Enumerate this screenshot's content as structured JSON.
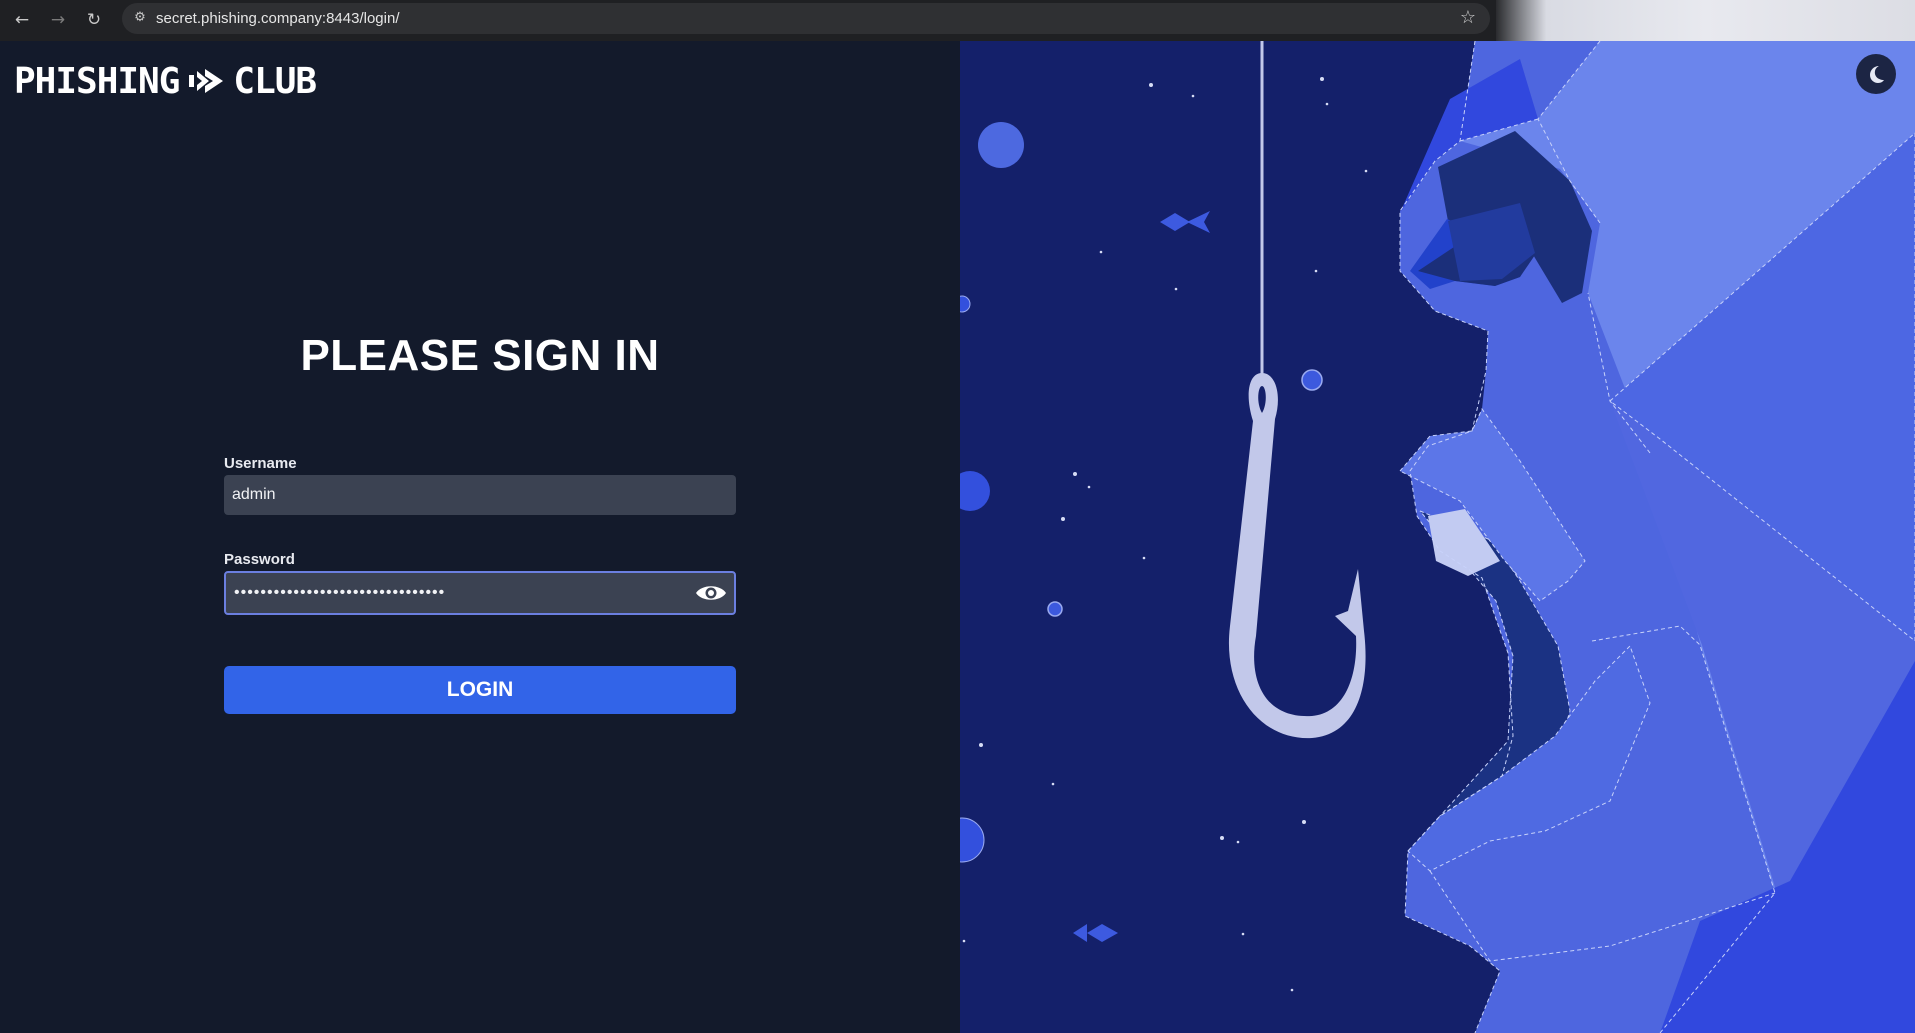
{
  "browser": {
    "url": "secret.phishing.company:8443/login/"
  },
  "brand": {
    "logo_left": "PHISHING",
    "logo_right": "CLUB"
  },
  "login": {
    "heading": "PLEASE SIGN IN",
    "username_label": "Username",
    "username_value": "admin",
    "password_label": "Password",
    "password_value": "••••••••••••••••••••••••••••••••",
    "submit_label": "LOGIN"
  },
  "colors": {
    "page_background": "#131a2b",
    "input_background": "#3b4252",
    "accent": "#3264e8",
    "illustration_background": "#14206a"
  },
  "icons": {
    "back": "arrow-left-icon",
    "forward": "arrow-right-icon",
    "reload": "reload-icon",
    "site_info": "tune-icon",
    "bookmark": "star-icon",
    "password_toggle": "eye-icon",
    "theme_toggle": "moon-icon"
  }
}
